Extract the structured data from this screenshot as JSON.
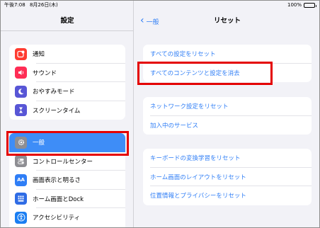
{
  "status_bar": {
    "time": "午後7:08",
    "date": "8月26日(木)",
    "battery_percent": "100%",
    "battery_level": 1.0
  },
  "sidebar": {
    "title": "設定",
    "group1": [
      {
        "label": "通知",
        "icon": "notification-icon",
        "color": "#ff3b30"
      },
      {
        "label": "サウンド",
        "icon": "speaker-icon",
        "color": "#ff2d55"
      },
      {
        "label": "おやすみモード",
        "icon": "moon-icon",
        "color": "#5856d6"
      },
      {
        "label": "スクリーンタイム",
        "icon": "hourglass-icon",
        "color": "#5856d6"
      }
    ],
    "group2": [
      {
        "label": "一般",
        "icon": "gear-icon",
        "color": "#8e8e93",
        "selected": true
      },
      {
        "label": "コントロールセンター",
        "icon": "toggle-icon",
        "color": "#8e8e93"
      },
      {
        "label": "画面表示と明るさ",
        "icon": "text-size-icon",
        "color": "#2f7ef6"
      },
      {
        "label": "ホーム画面とDock",
        "icon": "home-grid-icon",
        "color": "#2f6ce5"
      },
      {
        "label": "アクセシビリティ",
        "icon": "accessibility-icon",
        "color": "#1a7ef2"
      }
    ]
  },
  "detail": {
    "back_label": "一般",
    "title": "リセット",
    "group1": [
      "すべての設定をリセット",
      "すべてのコンテンツと設定を消去"
    ],
    "group2": [
      "ネットワーク設定をリセット",
      "加入中のサービス"
    ],
    "group3": [
      "キーボードの変換学習をリセット",
      "ホーム画面のレイアウトをリセット",
      "位置情報とプライバシーをリセット"
    ]
  },
  "colors": {
    "accent": "#2f7ef6",
    "selected_row": "#3e8df7",
    "highlight_box": "#e40000",
    "background": "#f2f2f7"
  }
}
